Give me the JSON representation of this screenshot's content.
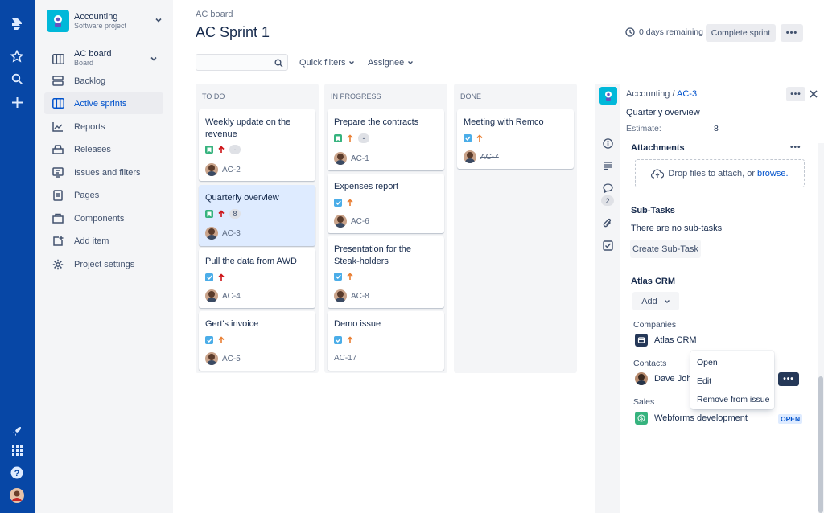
{
  "colors": {
    "nav": "#0747a6",
    "accent": "#0052cc",
    "story": "#36b37e",
    "task": "#4bade8",
    "high": "#cd1317",
    "medium": "#e97f33"
  },
  "project": {
    "name": "Accounting",
    "type": "Software project"
  },
  "board_selector": {
    "name": "AC board",
    "sub": "Board"
  },
  "sidebar": {
    "items": [
      {
        "label": "Backlog",
        "icon": "backlog-icon"
      },
      {
        "label": "Active sprints",
        "icon": "board-icon"
      },
      {
        "label": "Reports",
        "icon": "reports-icon"
      },
      {
        "label": "Releases",
        "icon": "releases-icon"
      },
      {
        "label": "Issues and filters",
        "icon": "issues-icon"
      },
      {
        "label": "Pages",
        "icon": "pages-icon"
      },
      {
        "label": "Components",
        "icon": "components-icon"
      },
      {
        "label": "Add item",
        "icon": "add-item-icon"
      },
      {
        "label": "Project settings",
        "icon": "gear-icon"
      }
    ]
  },
  "header": {
    "breadcrumb": "AC board",
    "title": "AC Sprint 1",
    "days_remaining": "0 days remaining",
    "complete_sprint": "Complete sprint",
    "more": "•••"
  },
  "filters": {
    "search_placeholder": "",
    "quick_filters": "Quick filters",
    "assignee": "Assignee"
  },
  "columns": [
    {
      "title": "TO DO",
      "cards": [
        {
          "title": "Weekly update on the revenue",
          "type": "story",
          "priority": "high",
          "estimate": "-",
          "key": "AC-2"
        },
        {
          "title": "Quarterly overview",
          "type": "story",
          "priority": "high",
          "estimate": "8",
          "key": "AC-3"
        },
        {
          "title": "Pull the data from AWD",
          "type": "task",
          "priority": "high",
          "key": "AC-4"
        },
        {
          "title": "Gert's invoice",
          "type": "task",
          "priority": "medium",
          "key": "AC-5"
        }
      ]
    },
    {
      "title": "IN PROGRESS",
      "cards": [
        {
          "title": "Prepare the contracts",
          "type": "story",
          "priority": "medium",
          "estimate": "-",
          "key": "AC-1"
        },
        {
          "title": "Expenses report",
          "type": "task",
          "priority": "medium",
          "key": "AC-6"
        },
        {
          "title": "Presentation for the Steak-holders",
          "type": "task",
          "priority": "medium",
          "key": "AC-8"
        },
        {
          "title": "Demo issue",
          "type": "task",
          "priority": "medium",
          "key": "AC-17"
        }
      ]
    },
    {
      "title": "DONE",
      "cards": [
        {
          "title": "Meeting with Remco",
          "type": "task",
          "priority": "medium",
          "key": "AC-7"
        }
      ]
    }
  ],
  "detail": {
    "project": "Accounting",
    "separator": "/",
    "key": "AC-3",
    "summary": "Quarterly overview",
    "estimate_label": "Estimate:",
    "estimate_value": "8",
    "attachments_heading": "Attachments",
    "drop_text": "Drop files to attach, or",
    "browse": "browse.",
    "subtasks_heading": "Sub-Tasks",
    "no_subtasks": "There are no sub-tasks",
    "create_subtask": "Create Sub-Task",
    "comment_count": "2",
    "crm": {
      "heading": "Atlas CRM",
      "add_label": "Add",
      "companies_label": "Companies",
      "company": "Atlas CRM",
      "contacts_label": "Contacts",
      "contact": "Dave John",
      "sales_label": "Sales",
      "sale": "Webforms development",
      "sale_status": "OPEN"
    }
  },
  "context_menu": {
    "items": [
      "Open",
      "Edit",
      "Remove from issue"
    ]
  }
}
